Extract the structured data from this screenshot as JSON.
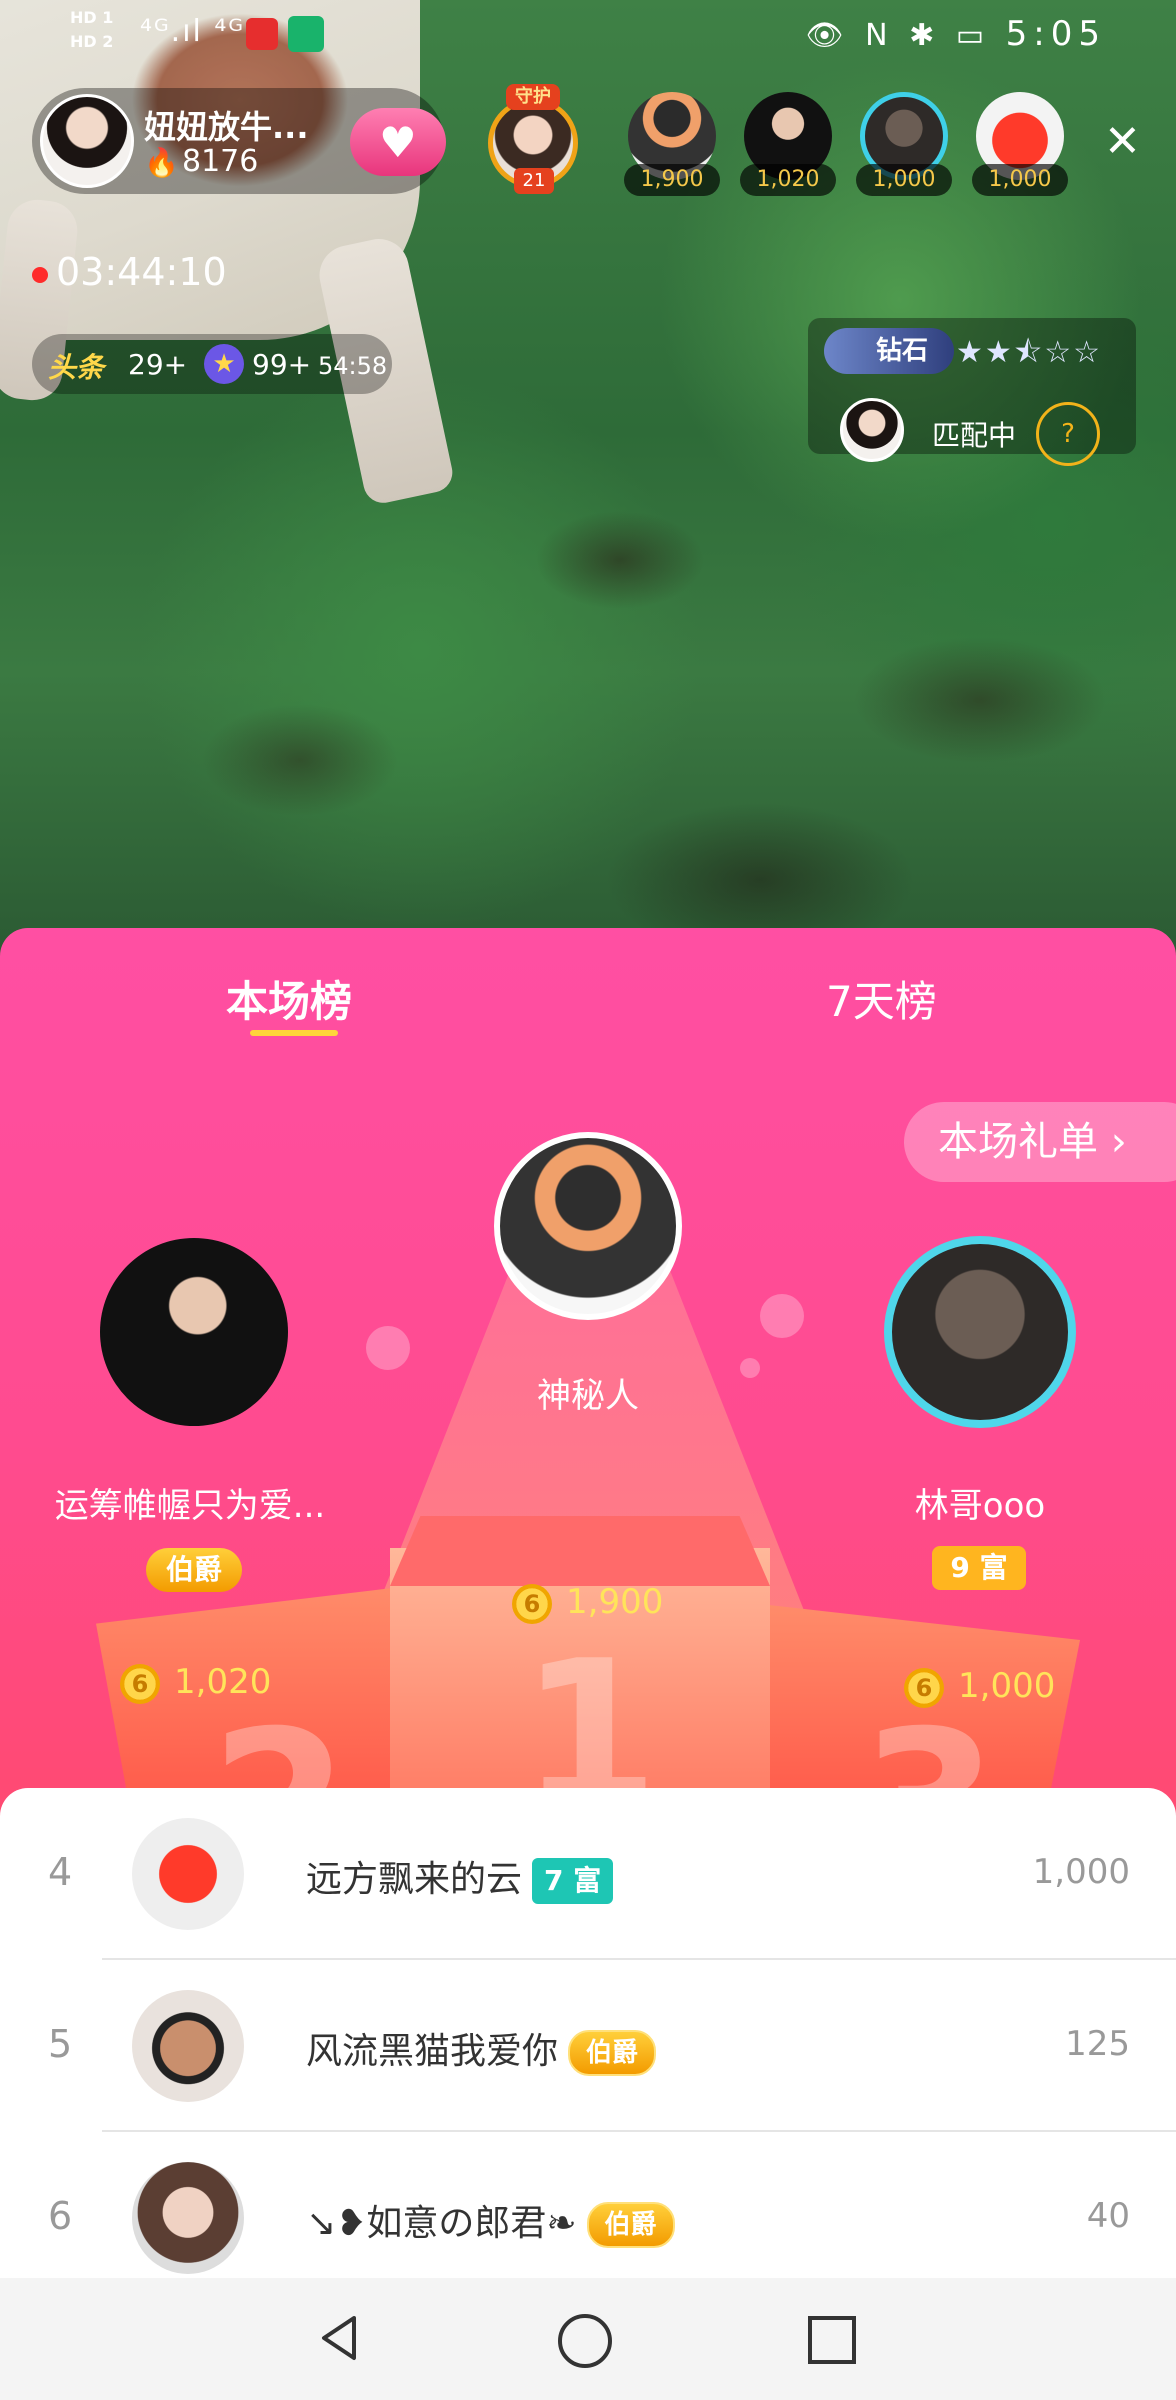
{
  "status_bar": {
    "hd_labels": "HD 1\nHD 2",
    "signal": "⁴ᴳ.ıl ⁴ᴳ.ıl",
    "right_icons": "👁 N ✱ ▭",
    "time": "5:05"
  },
  "host": {
    "name": "妞妞放牛...",
    "fans": "8176"
  },
  "guard": {
    "tag": "守护",
    "count": "21"
  },
  "top_viewers": [
    {
      "points": "1,900",
      "icon": "spy-avatar"
    },
    {
      "points": "1,020",
      "icon": "woman-avatar"
    },
    {
      "points": "1,000",
      "icon": "man-avatar"
    },
    {
      "points": "1,000",
      "icon": "red-face-avatar"
    }
  ],
  "live_timer": "03:44:10",
  "chips": {
    "headline_label": "头条",
    "headline_count": "29+",
    "star_count": "99+",
    "star_time": "54:58"
  },
  "rank_card": {
    "tier": "钻石",
    "stars": "★★⯪☆☆",
    "status": "匹配中",
    "help": "?"
  },
  "tabs": {
    "current": "本场榜",
    "week": "7天榜"
  },
  "gift_list_label": "本场礼单 ›",
  "podium": {
    "first": {
      "name": "神秘人",
      "coins": "1,900"
    },
    "second": {
      "name": "运筹帷幄只为爱...",
      "badge": "伯爵",
      "coins": "1,020"
    },
    "third": {
      "name": "林哥ooo",
      "badge": "9 富",
      "coins": "1,000"
    },
    "numbers": [
      "1",
      "2",
      "3"
    ],
    "coin_symbol": "6"
  },
  "ranking_list": [
    {
      "rank": "4",
      "name": "远方飘来的云",
      "badge": "7 富",
      "badge_type": "rich",
      "value": "1,000"
    },
    {
      "rank": "5",
      "name": "风流黑猫我爱你",
      "badge": "伯爵",
      "badge_type": "noble",
      "value": "125"
    },
    {
      "rank": "6",
      "name": "↘❥如意の郎君❧",
      "badge": "伯爵",
      "badge_type": "noble",
      "value": "40"
    }
  ],
  "colors": {
    "panel_top": "#ff4fa3",
    "panel_bottom": "#ff5a55",
    "gold": "#ffe45a",
    "rich_badge": "#1ec6b4",
    "noble_badge": "#f39b00"
  }
}
